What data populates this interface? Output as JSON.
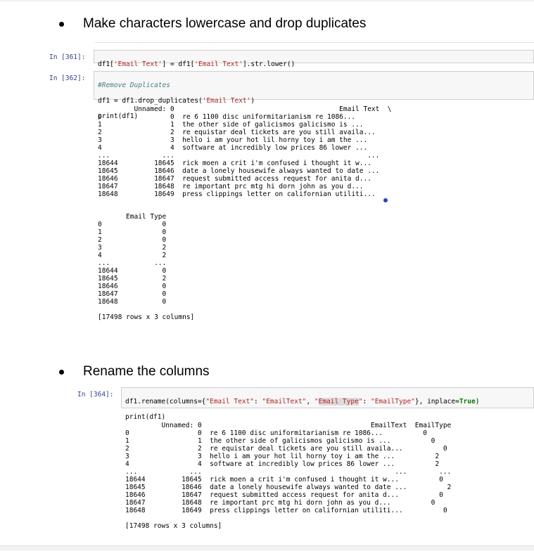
{
  "sections": {
    "lowercase_heading": "Make characters lowercase and drop duplicates",
    "rename_heading": "Rename the columns"
  },
  "cells": {
    "c361": {
      "prompt": "In [361]:",
      "code_a": "df1[",
      "code_s1": "'Email Text'",
      "code_b": "] = df1[",
      "code_s2": "'Email Text'",
      "code_c": "].str.lower()"
    },
    "c362": {
      "prompt": "In [362]:",
      "comment": "#Remove Duplicates",
      "line2_a": "df1 = df1.drop_duplicates(",
      "line2_s": "'Email Text'",
      "line2_b": ")",
      "line3": "print(df1)"
    },
    "c364": {
      "prompt": "In [364]:",
      "a": "df1.rename(columns={",
      "s1": "\"Email Text\"",
      "b": ": ",
      "s2": "\"EmailText\"",
      "c": ", ",
      "s3a": "\"",
      "s3hl": "Email Type",
      "s3b": "\"",
      "d": ": ",
      "s4": "\"EmailType\"",
      "e": "}, inplace=",
      "kw": "True",
      "f": ")",
      "line2": "print(df1)"
    }
  },
  "outputs": {
    "out362_part1": "         Unnamed: 0                                         Email Text  \\\n0                 0  re 6 1100 disc uniformitarianism re 1086...   \n1                 1  the other side of galicismos galicismo is ...   \n2                 2  re equistar deal tickets are you still availa...   \n3                 3  hello i am your hot lil horny toy i am the ...   \n4                 4  software at incredibly low prices 86 lower ...   \n...             ...                                                ...   \n18644         18645  rick moen a crit i'm confused i thought it w...   \n18645         18646  date a lonely housewife always wanted to date ...   \n18646         18647  request submitted access request for anita d...   \n18647         18648  re important prc mtg hi dorn john as you d...   \n18648         18649  press clippings letter on californian utiliti...",
    "out362_part2": "       Email Type\n0               0\n1               0\n2               0\n3               2\n4               2\n...           ...\n18644           0\n18645           2\n18646           0\n18647           0\n18648           0\n\n[17498 rows x 3 columns]",
    "out364": "         Unnamed: 0                                          EmailText  EmailType\n0                 0  re 6 1100 disc uniformitarianism re 1086...          0\n1                 1  the other side of galicismos galicismo is ...          0\n2                 2  re equistar deal tickets are you still availa...          0\n3                 3  hello i am your hot lil horny toy i am the ...          2\n4                 4  software at incredibly low prices 86 lower ...          2\n...             ...                                                ...        ...\n18644         18645  rick moen a crit i'm confused i thought it w...          0\n18645         18646  date a lonely housewife always wanted to date ...          2\n18646         18647  request submitted access request for anita d...          0\n18647         18648  re important prc mtg hi dorn john as you d...          0\n18648         18649  press clippings letter on californian utiliti...          0\n\n[17498 rows x 3 columns]"
  },
  "colors": {
    "prompt": "#303f9f",
    "string": "#ba2121",
    "comment": "#408080",
    "keyword": "#008000",
    "cell_bg": "#f7f7f7",
    "cursor_dot": "#1a46d6"
  }
}
